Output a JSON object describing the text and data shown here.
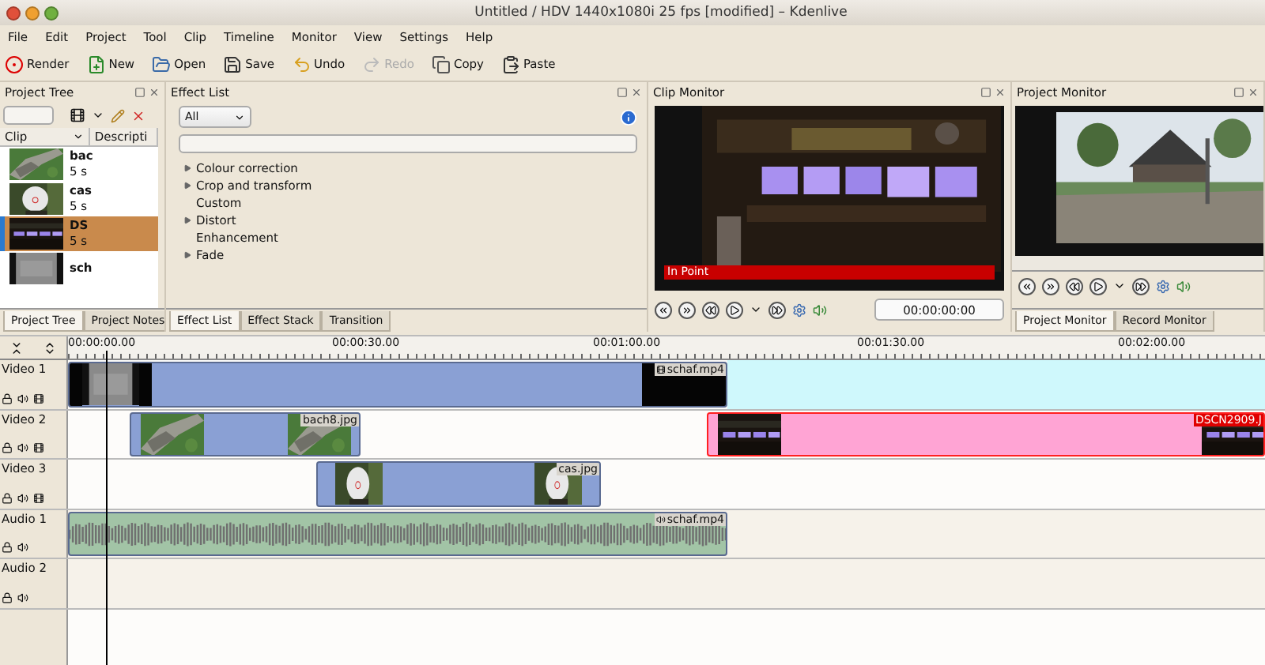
{
  "window": {
    "title": "Untitled / HDV 1440x1080i 25 fps [modified] – Kdenlive"
  },
  "menu": [
    "File",
    "Edit",
    "Project",
    "Tool",
    "Clip",
    "Timeline",
    "Monitor",
    "View",
    "Settings",
    "Help"
  ],
  "toolbar": [
    {
      "label": "Render",
      "kind": "render",
      "disabled": false
    },
    {
      "label": "New",
      "kind": "new",
      "disabled": false
    },
    {
      "label": "Open",
      "kind": "open",
      "disabled": false
    },
    {
      "label": "Save",
      "kind": "save",
      "disabled": false
    },
    {
      "label": "Undo",
      "kind": "undo",
      "disabled": false
    },
    {
      "label": "Redo",
      "kind": "redo",
      "disabled": true
    },
    {
      "label": "Copy",
      "kind": "copy",
      "disabled": false
    },
    {
      "label": "Paste",
      "kind": "paste",
      "disabled": false
    }
  ],
  "project_tree": {
    "title": "Project Tree",
    "columns": [
      "Clip",
      "Descripti"
    ],
    "rows": [
      {
        "name": "bac",
        "duration": "5 s",
        "selected": false
      },
      {
        "name": "cas",
        "duration": "5 s",
        "selected": false
      },
      {
        "name": "DS",
        "duration": "5 s",
        "selected": true
      },
      {
        "name": "sch",
        "selected": false
      }
    ],
    "tabs": [
      {
        "label": "Project Tree",
        "selected": true
      },
      {
        "label": "Project Notes",
        "selected": false
      }
    ]
  },
  "effect_list": {
    "title": "Effect List",
    "filter": "All",
    "items": [
      {
        "label": "Colour correction",
        "expandable": true
      },
      {
        "label": "Crop and transform",
        "expandable": true
      },
      {
        "label": "Custom",
        "expandable": false
      },
      {
        "label": "Distort",
        "expandable": true
      },
      {
        "label": "Enhancement",
        "expandable": false
      },
      {
        "label": "Fade",
        "expandable": true
      }
    ],
    "tabs": [
      {
        "label": "Effect List",
        "selected": true
      },
      {
        "label": "Effect Stack",
        "selected": false
      },
      {
        "label": "Transition",
        "selected": false
      }
    ]
  },
  "clip_monitor": {
    "title": "Clip Monitor",
    "overlay": "In Point",
    "timecode": "00:00:00:00"
  },
  "project_monitor": {
    "title": "Project Monitor",
    "tabs": [
      {
        "label": "Project Monitor",
        "selected": true
      },
      {
        "label": "Record Monitor",
        "selected": false
      }
    ]
  },
  "timeline": {
    "ruler": [
      "00:00:00.00",
      "00:00:30.00",
      "00:01:00.00",
      "00:01:30.00",
      "00:02:00.00"
    ],
    "tracks": [
      {
        "name": "Video 1",
        "kind": "video",
        "clips": [
          {
            "label": "schaf.mp4",
            "kind": "video",
            "selected": false
          }
        ]
      },
      {
        "name": "Video 2",
        "kind": "video",
        "clips": [
          {
            "label": "bach8.jpg",
            "selected": false
          },
          {
            "label": "DSCN2909.J",
            "selected": true
          }
        ]
      },
      {
        "name": "Video 3",
        "kind": "video",
        "clips": [
          {
            "label": "cas.jpg",
            "selected": false
          }
        ]
      },
      {
        "name": "Audio 1",
        "kind": "audio",
        "clips": [
          {
            "label": "schaf.mp4",
            "kind": "audio",
            "selected": false
          }
        ]
      },
      {
        "name": "Audio 2",
        "kind": "audio"
      }
    ]
  }
}
